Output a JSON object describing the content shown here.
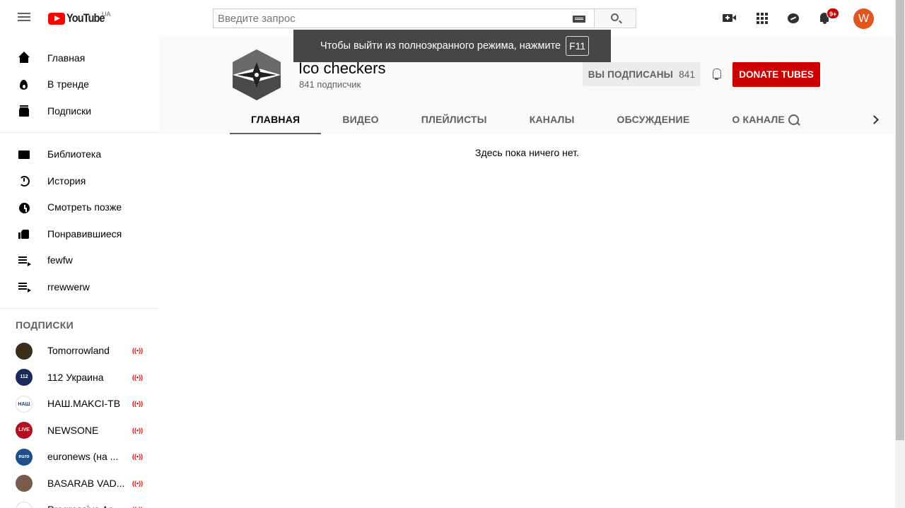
{
  "header": {
    "logo_text": "YouTube",
    "country_code": "UA",
    "search_placeholder": "Введите запрос",
    "notifications_badge": "9+",
    "avatar_letter": "W"
  },
  "fullscreen_toast": {
    "message": "Чтобы выйти из полноэкранного режима, нажмите",
    "key": "F11"
  },
  "sidebar": {
    "main_items": [
      {
        "label": "Главная",
        "icon": "home-icon"
      },
      {
        "label": "В тренде",
        "icon": "trending-icon"
      },
      {
        "label": "Подписки",
        "icon": "subscriptions-icon"
      }
    ],
    "library_items": [
      {
        "label": "Библиотека",
        "icon": "library-icon"
      },
      {
        "label": "История",
        "icon": "history-icon"
      },
      {
        "label": "Смотреть позже",
        "icon": "watch-later-icon"
      },
      {
        "label": "Понравившиеся",
        "icon": "liked-icon"
      },
      {
        "label": "fewfw",
        "icon": "playlist-icon"
      },
      {
        "label": "rrewwerw",
        "icon": "playlist-icon"
      }
    ],
    "subscriptions_title": "ПОДПИСКИ",
    "subscriptions": [
      {
        "label": "Tomorrowland",
        "live": "((•))",
        "avatar_color": "#3a2e1a",
        "avatar_text": ""
      },
      {
        "label": "112 Украина",
        "live": "((•))",
        "avatar_color": "#1a2a5c",
        "avatar_text": "112"
      },
      {
        "label": "НАШ.MAKCI-TB",
        "live": "((•))",
        "avatar_color": "#ffffff",
        "avatar_text": "НАШ"
      },
      {
        "label": "NEWSONE",
        "live": "((•))",
        "avatar_color": "#b01020",
        "avatar_text": "LIVE"
      },
      {
        "label": "euronews (на ...",
        "live": "((•))",
        "avatar_color": "#1d4f8c",
        "avatar_text": "euro"
      },
      {
        "label": "BASARAB VAD...",
        "live": "((•))",
        "avatar_color": "#7a5a4a",
        "avatar_text": ""
      },
      {
        "label": "Progressive As...",
        "live": "((•))",
        "avatar_color": "#ffffff",
        "avatar_text": ""
      }
    ]
  },
  "channel": {
    "name": "Ico checkers",
    "subscribers": "841 подписчик",
    "subscribed_label": "ВЫ ПОДПИСАНЫ",
    "subscribed_count": "841",
    "donate_label": "DONATE TUBES",
    "tabs": [
      "ГЛАВНАЯ",
      "ВИДЕО",
      "ПЛЕЙЛИСТЫ",
      "КАНАЛЫ",
      "ОБСУЖДЕНИЕ",
      "О КАНАЛЕ"
    ],
    "empty_message": "Здесь пока ничего нет."
  }
}
